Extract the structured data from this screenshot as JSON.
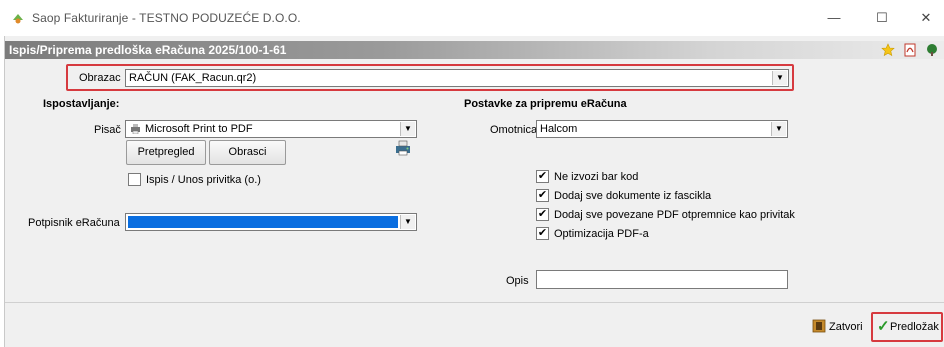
{
  "titlebar": {
    "title": "Saop Fakturiranje - TESTNO PODUZEĆE D.O.O.",
    "minimize_glyph": "—",
    "maximize_glyph": "☐",
    "close_glyph": "✕"
  },
  "header": {
    "title": "Ispis/Priprema predloška eRačuna 2025/100-1-61"
  },
  "obrazac": {
    "label": "Obrazac",
    "value": "RAČUN  (FAK_Racun.qr2)"
  },
  "ispostavljanje": {
    "heading": "Ispostavljanje:",
    "pisac_label": "Pisač",
    "pisac_value": "Microsoft Print to PDF",
    "pretpregled_label": "Pretpregled",
    "obrasci_label": "Obrasci",
    "ispis_checkbox_label": "Ispis / Unos privitka (o.)",
    "ispis_checked": false
  },
  "potpisnik": {
    "label": "Potpisnik eRačuna",
    "value": ""
  },
  "postavke": {
    "heading": "Postavke za pripremu eRačuna",
    "omotnica_label": "Omotnica",
    "omotnica_value": "Halcom",
    "options": [
      {
        "label": "Ne izvozi bar kod",
        "checked": true
      },
      {
        "label": "Dodaj sve dokumente iz fascikla",
        "checked": true
      },
      {
        "label": "Dodaj sve povezane PDF otpremnice kao privitak",
        "checked": true
      },
      {
        "label": "Optimizacija PDF-a",
        "checked": true
      }
    ],
    "opis_label": "Opis",
    "opis_value": ""
  },
  "footer": {
    "zatvori_label": "Zatvori",
    "predlozak_label": "Predložak"
  },
  "colors": {
    "highlight": "#d63a3f",
    "selection": "#0a6ee0",
    "check_green": "#2a9a2a"
  }
}
